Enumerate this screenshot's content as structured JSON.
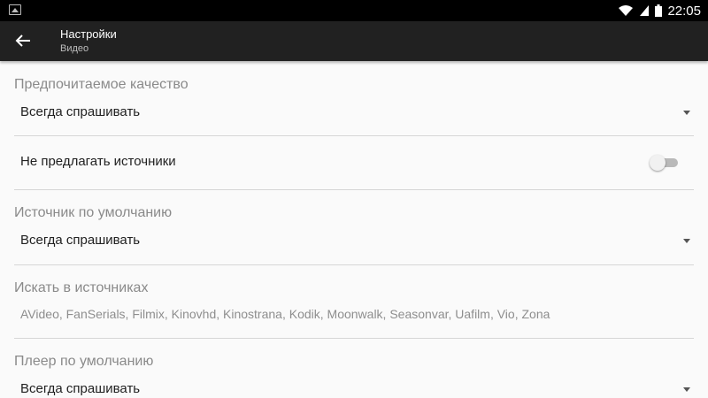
{
  "status_bar": {
    "time": "22:05",
    "icons": [
      "image-icon",
      "wifi-icon",
      "signal-icon",
      "battery-icon"
    ]
  },
  "toolbar": {
    "title": "Настройки",
    "subtitle": "Видео",
    "back_icon": "back-arrow-icon"
  },
  "settings": {
    "preferred_quality": {
      "label": "Предпочитаемое качество",
      "value": "Всегда спрашивать"
    },
    "dont_suggest_sources": {
      "label": "Не предлагать источники",
      "enabled": false
    },
    "default_source": {
      "label": "Источник по умолчанию",
      "value": "Всегда спрашивать"
    },
    "search_in_sources": {
      "label": "Искать в источниках",
      "value": "AVideo, FanSerials, Filmix, Kinovhd, Kinostrana, Kodik, Moonwalk, Seasonvar, Uafilm, Vio, Zona"
    },
    "default_player": {
      "label": "Плеер по умолчанию",
      "value": "Всегда спрашивать"
    }
  },
  "colors": {
    "toolbar_bg": "#212121",
    "page_bg": "#fafafa",
    "section_label": "#8a8a8a",
    "divider": "#d6d6d6"
  }
}
